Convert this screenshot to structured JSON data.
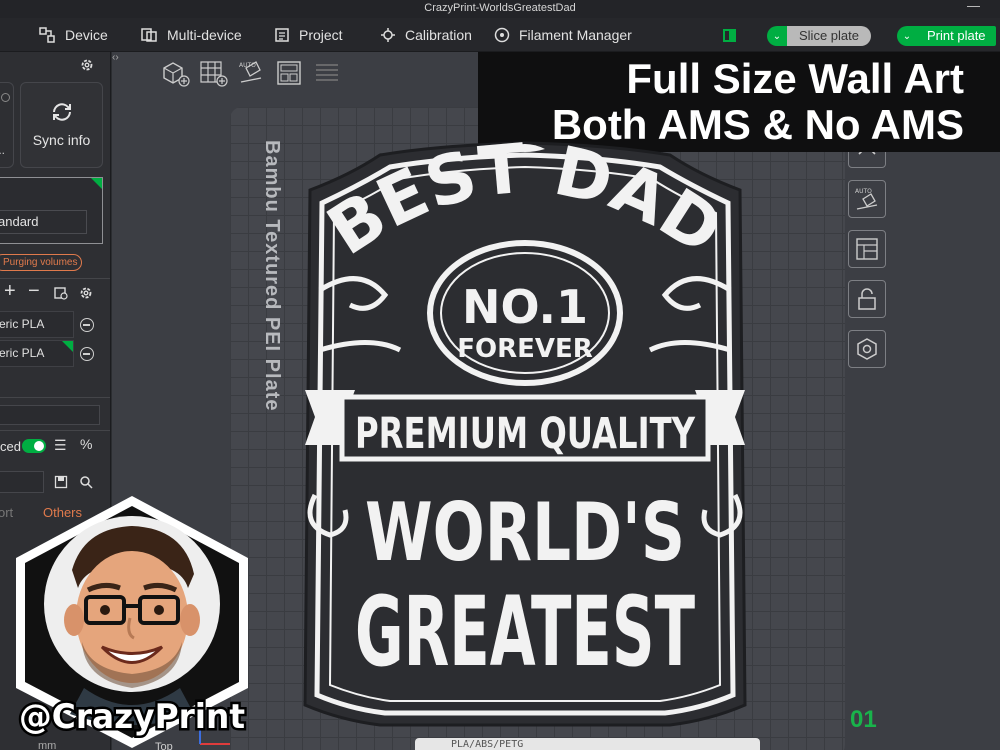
{
  "window": {
    "title": "CrazyPrint-WorldsGreatestDad",
    "minimize_glyph": "—"
  },
  "menu": {
    "items": [
      {
        "label": "Device",
        "icon": "device-icon"
      },
      {
        "label": "Multi-device",
        "icon": "multi-device-icon"
      },
      {
        "label": "Project",
        "icon": "project-icon"
      },
      {
        "label": "Calibration",
        "icon": "calibration-icon"
      },
      {
        "label": "Filament Manager",
        "icon": "filament-manager-icon"
      }
    ],
    "slice_label": "Slice plate",
    "print_label": "Print plate"
  },
  "left_panel": {
    "sync_label": "Sync info",
    "truncated_dots": "...",
    "preset_value": "andard",
    "purge_label": "Purging volumes",
    "filaments": [
      {
        "label": "eric PLA"
      },
      {
        "label": "eric PLA"
      }
    ],
    "advanced_label": "ced",
    "tab_left": "ort",
    "tab_right": "Others",
    "unit": "mm"
  },
  "canvas": {
    "bed_label": "Bambu Textured PEI Plate",
    "plate_number": "01",
    "view_label": "Top",
    "plate_bar_text": "PLA/ABS/PETG"
  },
  "caption": {
    "line1": "Full Size Wall Art",
    "line2": "Both AMS & No AMS"
  },
  "artwork": {
    "line1": "BEST DAD",
    "badge_line1": "NO.1",
    "badge_line2": "FOREVER",
    "banner": "PREMIUM QUALITY",
    "line2": "WORLD'S",
    "line3": "GREATEST"
  },
  "logo": {
    "handle": "@CrazyPrint"
  },
  "colors": {
    "accent": "#00ae42",
    "purge": "#e07a4c"
  }
}
